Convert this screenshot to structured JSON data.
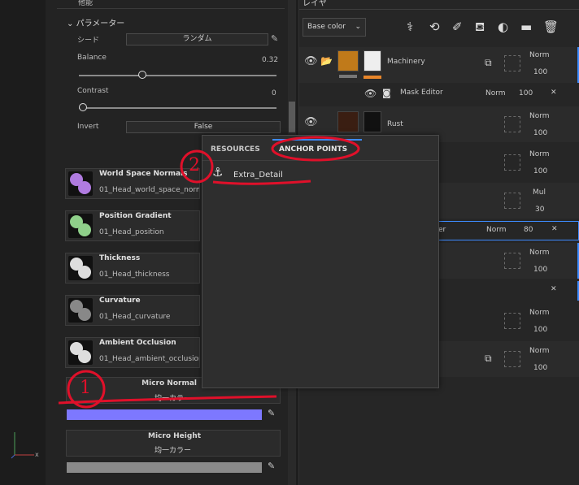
{
  "left_panel": {
    "section_top_label": "他能",
    "params_title": "パラメーター",
    "seed_label": "シード",
    "seed_value": "ランダム",
    "balance_label": "Balance",
    "balance_value": "0.32",
    "balance_level": 0.32,
    "contrast_label": "Contrast",
    "contrast_value": "0",
    "contrast_level": 0,
    "invert_label": "Invert",
    "invert_value": "False",
    "maps": [
      {
        "name": "World Space Normals",
        "file": "01_Head_world_space_normals"
      },
      {
        "name": "Position Gradient",
        "file": "01_Head_position"
      },
      {
        "name": "Thickness",
        "file": "01_Head_thickness"
      },
      {
        "name": "Curvature",
        "file": "01_Head_curvature"
      },
      {
        "name": "Ambient Occlusion",
        "file": "01_Head_ambient_occlusion"
      }
    ],
    "micro_normal": {
      "title": "Micro Normal",
      "sub": "均一カラー",
      "color": "#7d78ff"
    },
    "micro_height": {
      "title": "Micro Height",
      "sub": "均一カラー",
      "color": "#8a8a8a"
    },
    "axis_x": "x"
  },
  "right_panel": {
    "title": "レイヤ",
    "channel": "Base color",
    "layers": [
      {
        "name": "Machinery",
        "blend": "Norm",
        "opacity": "100"
      },
      {
        "name": "Mask Editor",
        "blend": "Norm",
        "opacity": "100"
      },
      {
        "name": "Rust",
        "blend": "Norm",
        "opacity": "100"
      },
      {
        "blend": "Norm",
        "opacity": "100"
      },
      {
        "blend": "Mul",
        "opacity": "30"
      },
      {
        "name": "er",
        "blend": "Norm",
        "opacity": "80"
      },
      {
        "blend": "Norm",
        "opacity": "100"
      },
      {
        "blend": "Norm",
        "opacity": "100"
      },
      {
        "blend": "Norm",
        "opacity": "100"
      }
    ]
  },
  "popup": {
    "tab_resources": "RESOURCES",
    "tab_anchor_points": "ANCHOR POINTS",
    "anchor_item": "Extra_Detail"
  },
  "annotations": {
    "one": "1",
    "two": "2"
  },
  "colors": {
    "accent": "#3d8bff",
    "orange": "#e8862a",
    "annotation": "#e0102a"
  }
}
